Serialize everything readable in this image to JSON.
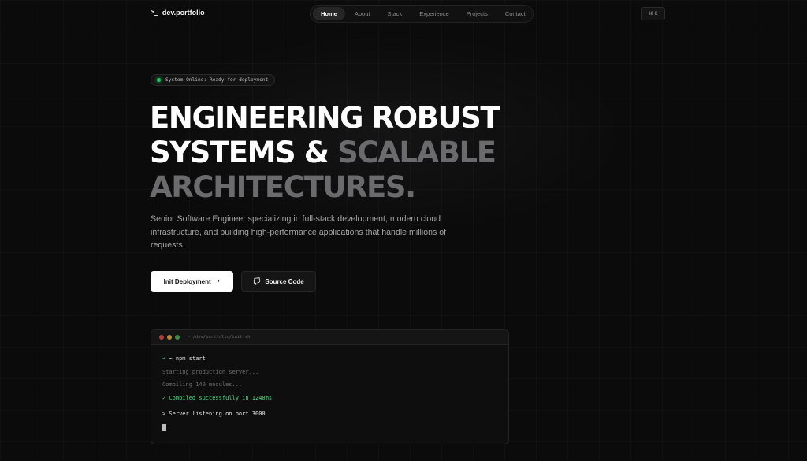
{
  "nav": {
    "logo_icon": ">_",
    "logo_text": "dev.portfolio",
    "links": [
      "Home",
      "About",
      "Stack",
      "Experience",
      "Projects",
      "Contact"
    ],
    "active": "Home",
    "command_shortcut": "⌘ K"
  },
  "hero": {
    "status": "System Online: Ready for deployment",
    "status_color": "#22c55e",
    "headline_line1": "ENGINEERING ROBUST",
    "headline_line2_white": "SYSTEMS &",
    "headline_line2_muted": "SCALABLE",
    "headline_line3_muted": "ARCHITECTURES.",
    "subtitle": "Senior Software Engineer specializing in full-stack development, modern cloud infrastructure, and building high-performance applications that handle millions of requests.",
    "primary_button": "Init Deployment",
    "secondary_button": "Source Code"
  },
  "terminal": {
    "path": "~ /dev/portfolio/init.sh",
    "prompt_symbol": "➜",
    "command": "~ npm start",
    "line1": "Starting production server...",
    "line2": "Compiling 140 modules...",
    "line3": "✓ Compiled successfully in 1240ms",
    "line4": "> Server listening on port 3000"
  }
}
